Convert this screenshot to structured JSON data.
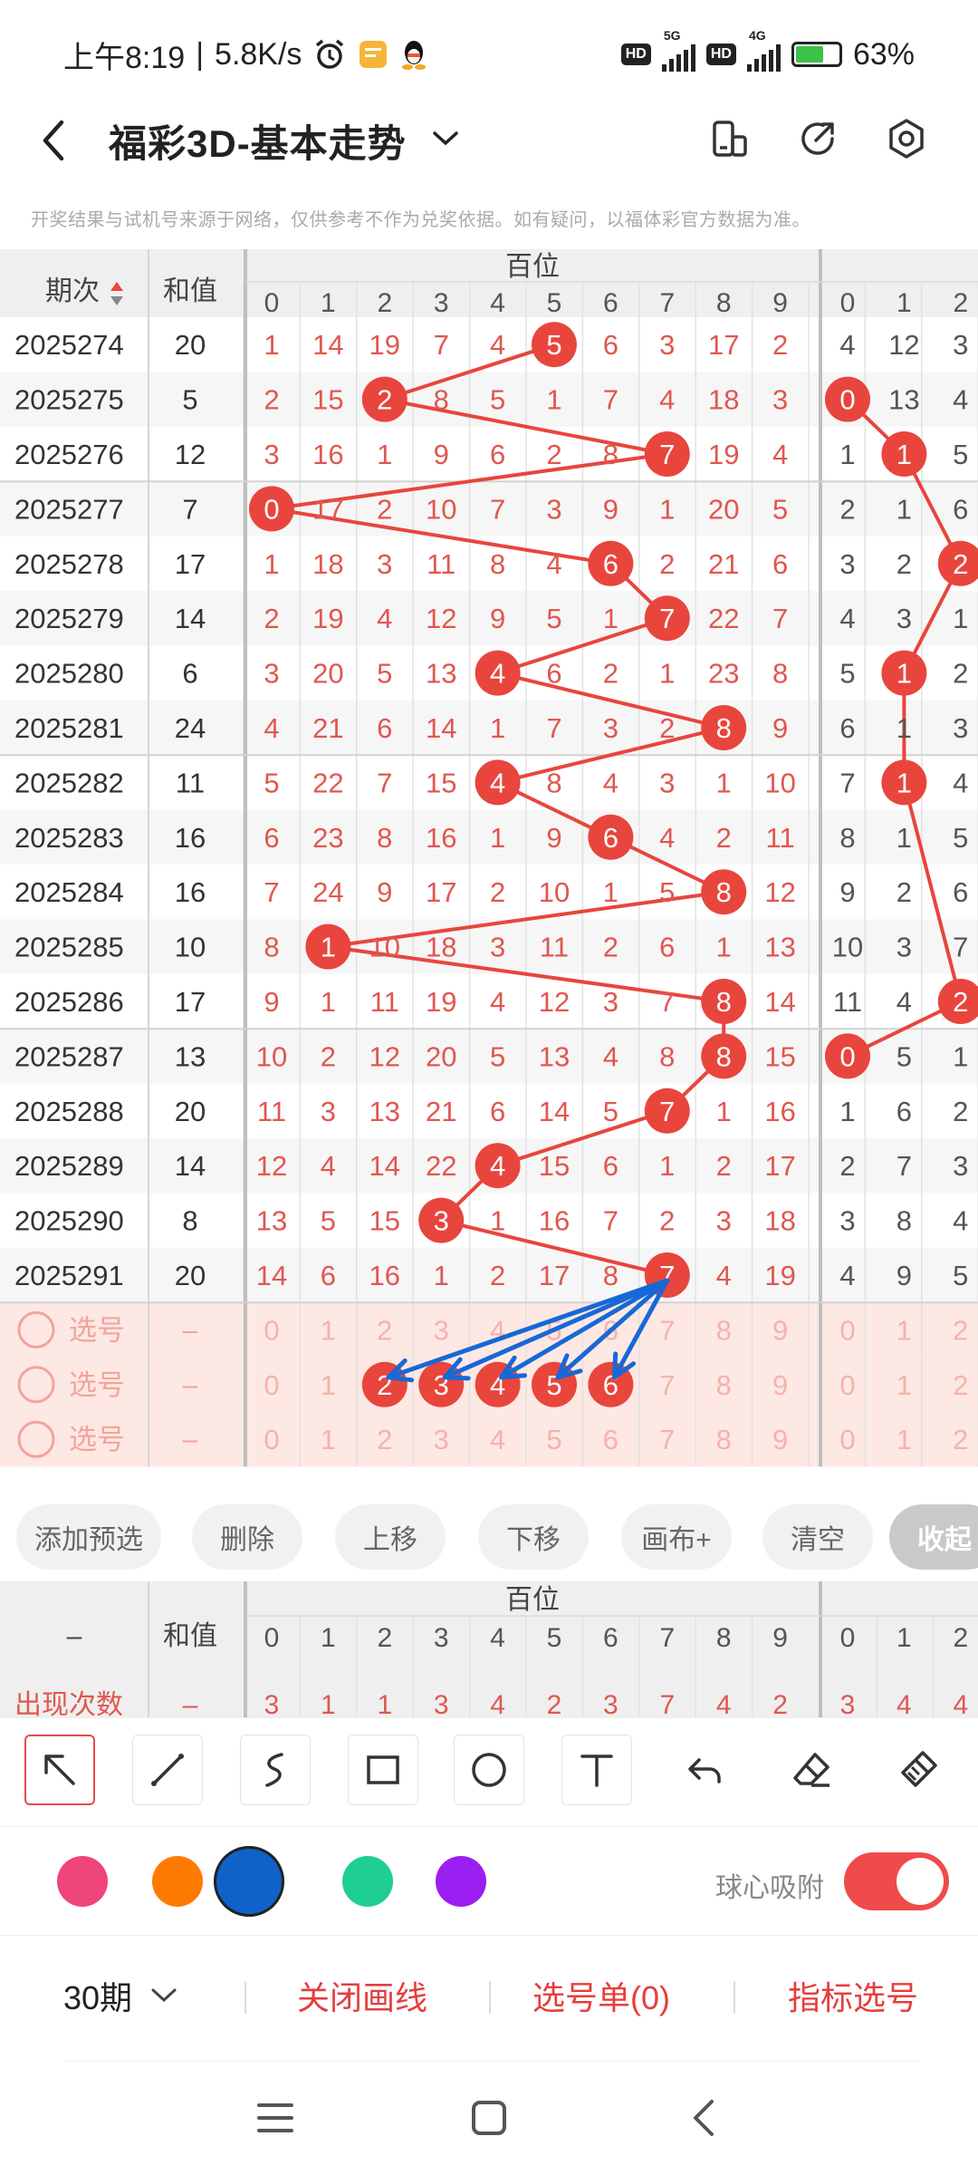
{
  "status_bar": {
    "time": "上午8:19",
    "speed": "5.8K/s",
    "sep": "|",
    "net1": "5G",
    "net2": "4G",
    "hd": "HD",
    "battery": "63%",
    "icons": [
      "alarm-icon",
      "notes-icon",
      "qq-icon",
      "hd-icon",
      "signal-5g-icon",
      "signal-4g-icon",
      "battery-icon"
    ]
  },
  "app_bar": {
    "title": "福彩3D-基本走势",
    "icons": [
      "back-icon",
      "dropdown-chevron-icon",
      "layout-icon",
      "share-icon",
      "settings-icon"
    ]
  },
  "notice": "开奖结果与试机号来源于网络，仅供参考不作为兑奖依据。如有疑问，以福体彩官方数据为准。",
  "table": {
    "col_period": "期次",
    "col_sum": "和值",
    "group_label": "百位",
    "digits": [
      "0",
      "1",
      "2",
      "3",
      "4",
      "5",
      "6",
      "7",
      "8",
      "9"
    ],
    "next_digits": [
      "0",
      "1",
      "2"
    ],
    "rows": [
      {
        "period": "2025274",
        "sum": "20",
        "cells": [
          "1",
          "14",
          "19",
          "7",
          "4",
          "5",
          "6",
          "3",
          "17",
          "2"
        ],
        "hit": 5,
        "next": [
          "4",
          "12",
          "3"
        ],
        "next_hit": -1
      },
      {
        "period": "2025275",
        "sum": "5",
        "cells": [
          "2",
          "15",
          "2",
          "8",
          "5",
          "1",
          "7",
          "4",
          "18",
          "3"
        ],
        "hit": 2,
        "next": [
          "0",
          "13",
          "4"
        ],
        "next_hit": 0
      },
      {
        "period": "2025276",
        "sum": "12",
        "cells": [
          "3",
          "16",
          "1",
          "9",
          "6",
          "2",
          "8",
          "7",
          "19",
          "4"
        ],
        "hit": 7,
        "next": [
          "1",
          "1",
          "5"
        ],
        "next_hit": 1
      },
      {
        "period": "2025277",
        "sum": "7",
        "cells": [
          "0",
          "17",
          "2",
          "10",
          "7",
          "3",
          "9",
          "1",
          "20",
          "5"
        ],
        "hit": 0,
        "next": [
          "2",
          "1",
          "6"
        ],
        "next_hit": -1
      },
      {
        "period": "2025278",
        "sum": "17",
        "cells": [
          "1",
          "18",
          "3",
          "11",
          "8",
          "4",
          "6",
          "2",
          "21",
          "6"
        ],
        "hit": 6,
        "next": [
          "3",
          "2",
          "2"
        ],
        "next_hit": 2
      },
      {
        "period": "2025279",
        "sum": "14",
        "cells": [
          "2",
          "19",
          "4",
          "12",
          "9",
          "5",
          "1",
          "7",
          "22",
          "7"
        ],
        "hit": 7,
        "next": [
          "4",
          "3",
          "1"
        ],
        "next_hit": -1
      },
      {
        "period": "2025280",
        "sum": "6",
        "cells": [
          "3",
          "20",
          "5",
          "13",
          "4",
          "6",
          "2",
          "1",
          "23",
          "8"
        ],
        "hit": 4,
        "next": [
          "5",
          "1",
          "2"
        ],
        "next_hit": 1
      },
      {
        "period": "2025281",
        "sum": "24",
        "cells": [
          "4",
          "21",
          "6",
          "14",
          "1",
          "7",
          "3",
          "2",
          "8",
          "9"
        ],
        "hit": 8,
        "next": [
          "6",
          "1",
          "3"
        ],
        "next_hit": -1
      },
      {
        "period": "2025282",
        "sum": "11",
        "cells": [
          "5",
          "22",
          "7",
          "15",
          "4",
          "8",
          "4",
          "3",
          "1",
          "10"
        ],
        "hit": 4,
        "next": [
          "7",
          "1",
          "4"
        ],
        "next_hit": 1
      },
      {
        "period": "2025283",
        "sum": "16",
        "cells": [
          "6",
          "23",
          "8",
          "16",
          "1",
          "9",
          "6",
          "4",
          "2",
          "11"
        ],
        "hit": 6,
        "next": [
          "8",
          "1",
          "5"
        ],
        "next_hit": -1
      },
      {
        "period": "2025284",
        "sum": "16",
        "cells": [
          "7",
          "24",
          "9",
          "17",
          "2",
          "10",
          "1",
          "5",
          "8",
          "12"
        ],
        "hit": 8,
        "next": [
          "9",
          "2",
          "6"
        ],
        "next_hit": -1
      },
      {
        "period": "2025285",
        "sum": "10",
        "cells": [
          "8",
          "1",
          "10",
          "18",
          "3",
          "11",
          "2",
          "6",
          "1",
          "13"
        ],
        "hit": 1,
        "next": [
          "10",
          "3",
          "7"
        ],
        "next_hit": -1
      },
      {
        "period": "2025286",
        "sum": "17",
        "cells": [
          "9",
          "1",
          "11",
          "19",
          "4",
          "12",
          "3",
          "7",
          "8",
          "14"
        ],
        "hit": 8,
        "next": [
          "11",
          "4",
          "2"
        ],
        "next_hit": 2
      },
      {
        "period": "2025287",
        "sum": "13",
        "cells": [
          "10",
          "2",
          "12",
          "20",
          "5",
          "13",
          "4",
          "8",
          "8",
          "15"
        ],
        "hit": 8,
        "next": [
          "0",
          "5",
          "1"
        ],
        "next_hit": 0
      },
      {
        "period": "2025288",
        "sum": "20",
        "cells": [
          "11",
          "3",
          "13",
          "21",
          "6",
          "14",
          "5",
          "7",
          "1",
          "16"
        ],
        "hit": 7,
        "next": [
          "1",
          "6",
          "2"
        ],
        "next_hit": -1
      },
      {
        "period": "2025289",
        "sum": "14",
        "cells": [
          "12",
          "4",
          "14",
          "22",
          "4",
          "15",
          "6",
          "1",
          "2",
          "17"
        ],
        "hit": 4,
        "next": [
          "2",
          "7",
          "3"
        ],
        "next_hit": -1
      },
      {
        "period": "2025290",
        "sum": "8",
        "cells": [
          "13",
          "5",
          "15",
          "3",
          "1",
          "16",
          "7",
          "2",
          "3",
          "18"
        ],
        "hit": 3,
        "next": [
          "3",
          "8",
          "4"
        ],
        "next_hit": -1
      },
      {
        "period": "2025291",
        "sum": "20",
        "cells": [
          "14",
          "6",
          "16",
          "1",
          "2",
          "17",
          "8",
          "7",
          "4",
          "19"
        ],
        "hit": 7,
        "next": [
          "4",
          "9",
          "5"
        ],
        "next_hit": -1
      }
    ],
    "select_rows": [
      {
        "label": "选号",
        "sum": "–",
        "picked": []
      },
      {
        "label": "选号",
        "sum": "–",
        "picked": [
          2,
          3,
          4,
          5,
          6
        ]
      },
      {
        "label": "选号",
        "sum": "–",
        "picked": []
      }
    ]
  },
  "actions": {
    "add_preselect": "添加预选",
    "delete": "删除",
    "move_up": "上移",
    "move_down": "下移",
    "canvas_plus": "画布+",
    "clear": "清空",
    "collapse": "收起"
  },
  "stats": {
    "dash": "–",
    "col_sum": "和值",
    "group_label": "百位",
    "row_label": "出现次数",
    "row_sum": "–",
    "row_values": [
      "3",
      "1",
      "1",
      "3",
      "4",
      "2",
      "3",
      "7",
      "4",
      "2",
      "3",
      "4",
      "4"
    ]
  },
  "draw_tools": [
    "pointer-arrow-icon",
    "line-tool-icon",
    "curve-tool-icon",
    "rectangle-tool-icon",
    "circle-tool-icon",
    "text-tool-icon",
    "undo-icon",
    "eraser-icon",
    "brush-clear-icon"
  ],
  "palette": {
    "colors": [
      "#f0457a",
      "#ff7a00",
      "#0f62c9",
      "#1fcf91",
      "#9a1ff0"
    ],
    "selected_index": 2,
    "snap_label": "球心吸附",
    "snap_on": true,
    "accent": "#e8453d",
    "draw_blue": "#1768d6"
  },
  "bottom_bar": {
    "periods": "30期",
    "close_lines": "关闭画线",
    "selection_list": "选号单(0)",
    "indicator_pick": "指标选号"
  },
  "nav": [
    "menu-icon",
    "home-icon",
    "back-nav-icon"
  ]
}
